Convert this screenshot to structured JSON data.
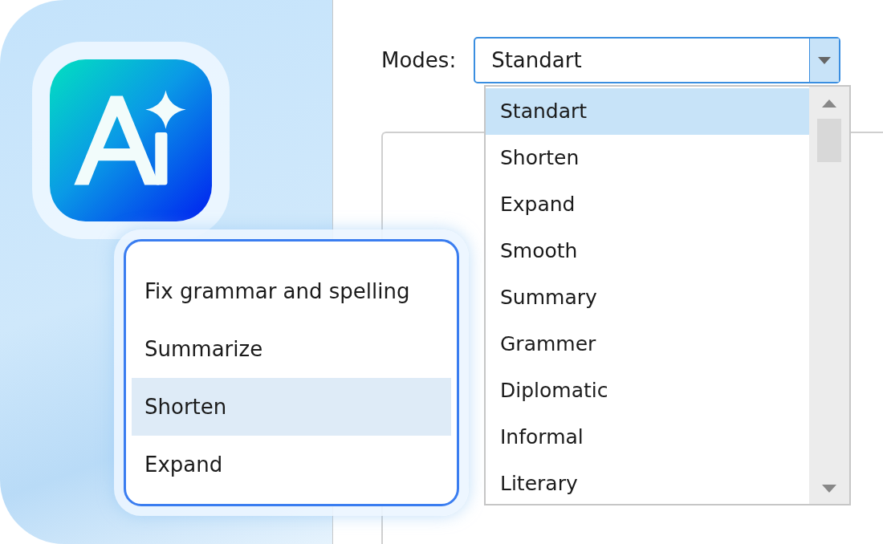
{
  "modes": {
    "label": "Modes:",
    "value": "Standart",
    "expanded": true,
    "options": [
      {
        "label": "Standart",
        "selected": true
      },
      {
        "label": "Shorten",
        "selected": false
      },
      {
        "label": "Expand",
        "selected": false
      },
      {
        "label": "Smooth",
        "selected": false
      },
      {
        "label": "Summary",
        "selected": false
      },
      {
        "label": "Grammer",
        "selected": false
      },
      {
        "label": "Diplomatic",
        "selected": false
      },
      {
        "label": "Informal",
        "selected": false
      },
      {
        "label": "Literary",
        "selected": false
      }
    ]
  },
  "quick_menu": {
    "items": [
      {
        "label": "Fix grammar and spelling",
        "selected": false
      },
      {
        "label": "Summarize",
        "selected": false
      },
      {
        "label": "Shorten",
        "selected": true
      },
      {
        "label": "Expand",
        "selected": false
      }
    ]
  }
}
